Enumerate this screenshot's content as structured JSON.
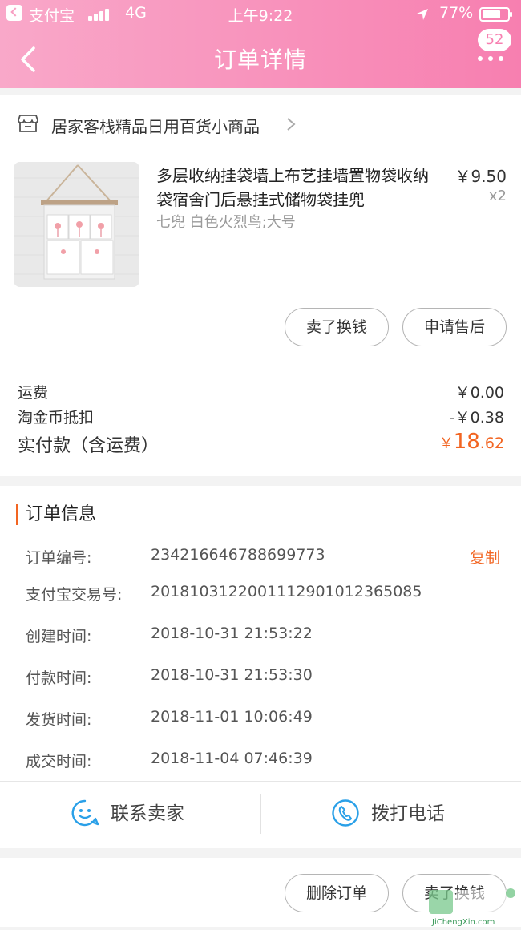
{
  "status_bar": {
    "carrier": "支付宝",
    "network": "4G",
    "time": "上午9:22",
    "battery": "77%"
  },
  "nav": {
    "title": "订单详情",
    "badge": "52"
  },
  "shop": {
    "name": "居家客栈精品日用百货小商品"
  },
  "product": {
    "title": "多层收纳挂袋墙上布艺挂墙置物袋收纳袋宿舍门后悬挂式储物袋挂兜",
    "sku": "七兜 白色火烈鸟;大号",
    "price": "￥9.50",
    "quantity": "x2",
    "actions": {
      "sell": "卖了换钱",
      "after_sale": "申请售后"
    }
  },
  "fees": {
    "shipping_label": "运费",
    "shipping_value": "￥0.00",
    "coin_label": "淘金币抵扣",
    "coin_value": "-￥0.38",
    "total_label": "实付款（含运费）",
    "total_currency": "￥",
    "total_int": "18",
    "total_dec": ".62"
  },
  "order_info": {
    "section_title": "订单信息",
    "copy_label": "复制",
    "rows": [
      {
        "label": "订单编号:",
        "value": "234216646788699773"
      },
      {
        "label": "支付宝交易号:",
        "value": "2018103122001112901012365085"
      },
      {
        "label": "创建时间:",
        "value": "2018-10-31 21:53:22"
      },
      {
        "label": "付款时间:",
        "value": "2018-10-31 21:53:30"
      },
      {
        "label": "发货时间:",
        "value": "2018-11-01 10:06:49"
      },
      {
        "label": "成交时间:",
        "value": "2018-11-04 07:46:39"
      }
    ]
  },
  "contact": {
    "seller": "联系卖家",
    "phone": "拨打电话"
  },
  "bottom_actions": {
    "delete": "删除订单",
    "sell": "卖了换钱"
  },
  "watermark": {
    "text": "JiChengXin.com"
  },
  "colors": {
    "header_start": "#f9a8c9",
    "header_end": "#f77fb0",
    "accent": "#f26522",
    "link_blue": "#2aa0e8"
  }
}
